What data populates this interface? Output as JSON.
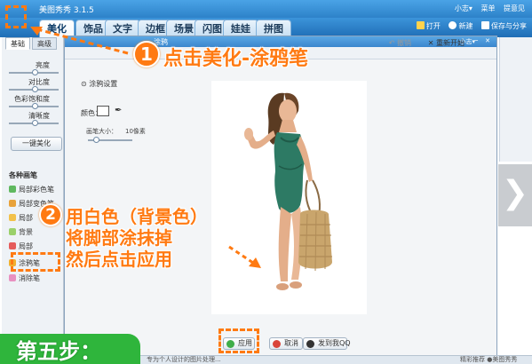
{
  "app": {
    "title": "美图秀秀 3.1.5",
    "top_links": [
      "小志▾",
      "菜单",
      "提意见"
    ],
    "nav_tabs": [
      "美化",
      "饰品",
      "文字",
      "边框",
      "场景",
      "闪图",
      "娃娃",
      "拼图"
    ],
    "right_tools": {
      "open": "打开",
      "new": "新建",
      "save_share": "保存与分享"
    }
  },
  "left_panel": {
    "tabs": [
      "基础",
      "高级"
    ],
    "sliders": [
      "亮度",
      "对比度",
      "色彩饱和度",
      "清晰度"
    ],
    "one_key_button": "一键美化",
    "brush_section_title": "各种画笔",
    "brushes": [
      "局部彩色笔",
      "局部变色笔",
      "局部",
      "背景",
      "局部",
      "涂鸦笔",
      "消除笔"
    ]
  },
  "dialog": {
    "title": "涂鸦",
    "user": "小志▾",
    "win_buttons": "─ ✕",
    "undo": "撤销",
    "restart": "重新开始",
    "settings_title": "涂鸦设置",
    "color_label": "颜色：",
    "brush_size_label": "画笔大小：",
    "brush_size_value": "10像素",
    "buttons": {
      "apply": "应用",
      "cancel": "取消",
      "share": "发到我QQ"
    }
  },
  "status": {
    "left": "专为个人设计的图片处理...",
    "right": "精彩推荐  ●美图秀秀"
  },
  "tutorial": {
    "step1_number": "1",
    "step1_text": "点击美化-涂鸦笔",
    "step2_number": "2",
    "step2_lines": [
      "用白色（背景色）",
      "将脚部涂抹掉",
      "然后点击应用"
    ],
    "step_banner": "第五步："
  },
  "colors": {
    "accent_orange": "#ff7a12",
    "title_blue": "#2d82c9",
    "banner_green": "#2fb53c"
  }
}
